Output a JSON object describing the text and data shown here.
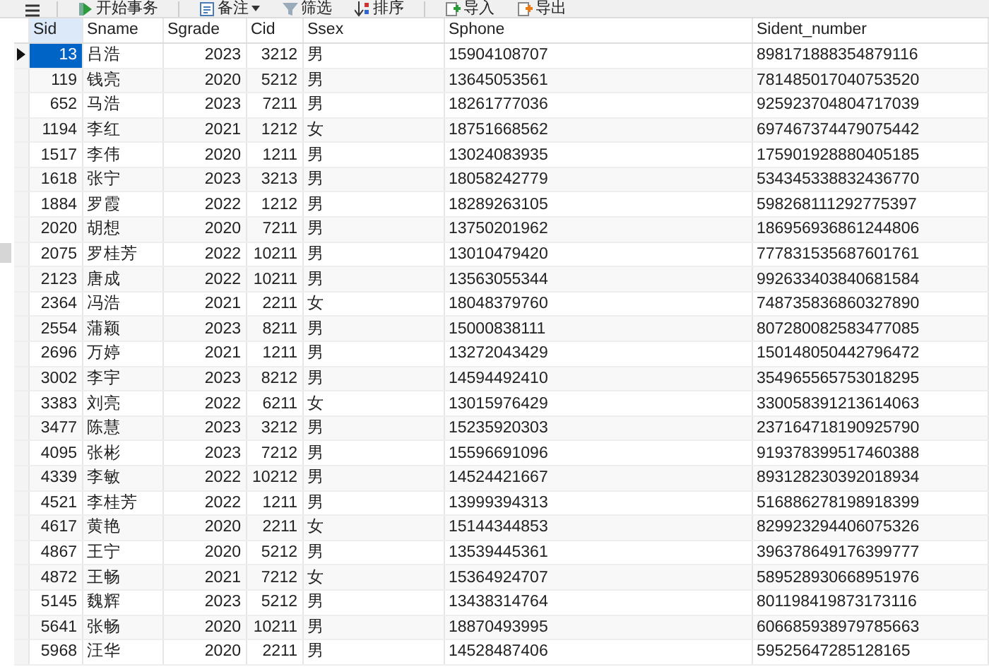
{
  "toolbar": [
    {
      "kind": "begin",
      "label": "开始事务"
    },
    {
      "kind": "note",
      "label": "备注",
      "dropdown": true
    },
    {
      "kind": "filter",
      "label": "筛选"
    },
    {
      "kind": "sort",
      "label": "排序"
    },
    {
      "kind": "import",
      "label": "导入"
    },
    {
      "kind": "export",
      "label": "导出"
    }
  ],
  "table": {
    "columns": [
      {
        "label": "Sid",
        "kind": "number",
        "selected": true
      },
      {
        "label": "Sname",
        "kind": "text",
        "selected": false
      },
      {
        "label": "Sgrade",
        "kind": "number",
        "selected": false
      },
      {
        "label": "Cid",
        "kind": "number",
        "selected": false
      },
      {
        "label": "Ssex",
        "kind": "text",
        "selected": false
      },
      {
        "label": "Sphone",
        "kind": "text",
        "selected": false
      },
      {
        "label": "Sident_number",
        "kind": "text",
        "selected": false
      }
    ],
    "rows": [
      {
        "selected": true,
        "cells": [
          "13",
          "吕浩",
          "2023",
          "3212",
          "男",
          "15904108707",
          "898171888354879116"
        ]
      },
      {
        "selected": false,
        "cells": [
          "119",
          "钱亮",
          "2020",
          "5212",
          "男",
          "13645053561",
          "781485017040753520"
        ]
      },
      {
        "selected": false,
        "cells": [
          "652",
          "马浩",
          "2023",
          "7211",
          "男",
          "18261777036",
          "925923704804717039"
        ]
      },
      {
        "selected": false,
        "cells": [
          "1194",
          "李红",
          "2021",
          "1212",
          "女",
          "18751668562",
          "697467374479075442"
        ]
      },
      {
        "selected": false,
        "cells": [
          "1517",
          "李伟",
          "2020",
          "1211",
          "男",
          "13024083935",
          "175901928880405185"
        ]
      },
      {
        "selected": false,
        "cells": [
          "1618",
          "张宁",
          "2023",
          "3213",
          "男",
          "18058242779",
          "534345338832436770"
        ]
      },
      {
        "selected": false,
        "cells": [
          "1884",
          "罗霞",
          "2022",
          "1212",
          "男",
          "18289263105",
          "598268111292775397"
        ]
      },
      {
        "selected": false,
        "cells": [
          "2020",
          "胡想",
          "2020",
          "7211",
          "男",
          "13750201962",
          "186956936861244806"
        ]
      },
      {
        "selected": false,
        "cells": [
          "2075",
          "罗桂芳",
          "2022",
          "10211",
          "男",
          "13010479420",
          "777831535687601761"
        ]
      },
      {
        "selected": false,
        "cells": [
          "2123",
          "唐成",
          "2022",
          "10211",
          "男",
          "13563055344",
          "992633403840681584"
        ]
      },
      {
        "selected": false,
        "cells": [
          "2364",
          "冯浩",
          "2021",
          "2211",
          "女",
          "18048379760",
          "748735836860327890"
        ]
      },
      {
        "selected": false,
        "cells": [
          "2554",
          "蒲颖",
          "2023",
          "8211",
          "男",
          "15000838111",
          "807280082583477085"
        ]
      },
      {
        "selected": false,
        "cells": [
          "2696",
          "万婷",
          "2021",
          "1211",
          "男",
          "13272043429",
          "150148050442796472"
        ]
      },
      {
        "selected": false,
        "cells": [
          "3002",
          "李宇",
          "2023",
          "8212",
          "男",
          "14594492410",
          "354965565753018295"
        ]
      },
      {
        "selected": false,
        "cells": [
          "3383",
          "刘亮",
          "2022",
          "6211",
          "女",
          "13015976429",
          "330058391213614063"
        ]
      },
      {
        "selected": false,
        "cells": [
          "3477",
          "陈慧",
          "2023",
          "3212",
          "男",
          "15235920303",
          "237164718190925790"
        ]
      },
      {
        "selected": false,
        "cells": [
          "4095",
          "张彬",
          "2023",
          "7212",
          "男",
          "15596691096",
          "919378399517460388"
        ]
      },
      {
        "selected": false,
        "cells": [
          "4339",
          "李敏",
          "2022",
          "10212",
          "男",
          "14524421667",
          "893128230392018934"
        ]
      },
      {
        "selected": false,
        "cells": [
          "4521",
          "李桂芳",
          "2022",
          "1211",
          "男",
          "13999394313",
          "516886278198918399"
        ]
      },
      {
        "selected": false,
        "cells": [
          "4617",
          "黄艳",
          "2020",
          "2211",
          "女",
          "15144344853",
          "829923294406075326"
        ]
      },
      {
        "selected": false,
        "cells": [
          "4867",
          "王宁",
          "2020",
          "5212",
          "男",
          "13539445361",
          "396378649176399777"
        ]
      },
      {
        "selected": false,
        "cells": [
          "4872",
          "王畅",
          "2021",
          "7212",
          "女",
          "15364924707",
          "589528930668951976"
        ]
      },
      {
        "selected": false,
        "cells": [
          "5145",
          "魏辉",
          "2023",
          "5212",
          "男",
          "13438314764",
          "801198419873173116"
        ]
      },
      {
        "selected": false,
        "cells": [
          "5641",
          "张畅",
          "2020",
          "10211",
          "男",
          "18870493995",
          "606685938979785663"
        ]
      },
      {
        "selected": false,
        "cells": [
          "5968",
          "汪华",
          "2020",
          "2211",
          "男",
          "14528487406",
          "59525647285128165"
        ]
      }
    ]
  }
}
